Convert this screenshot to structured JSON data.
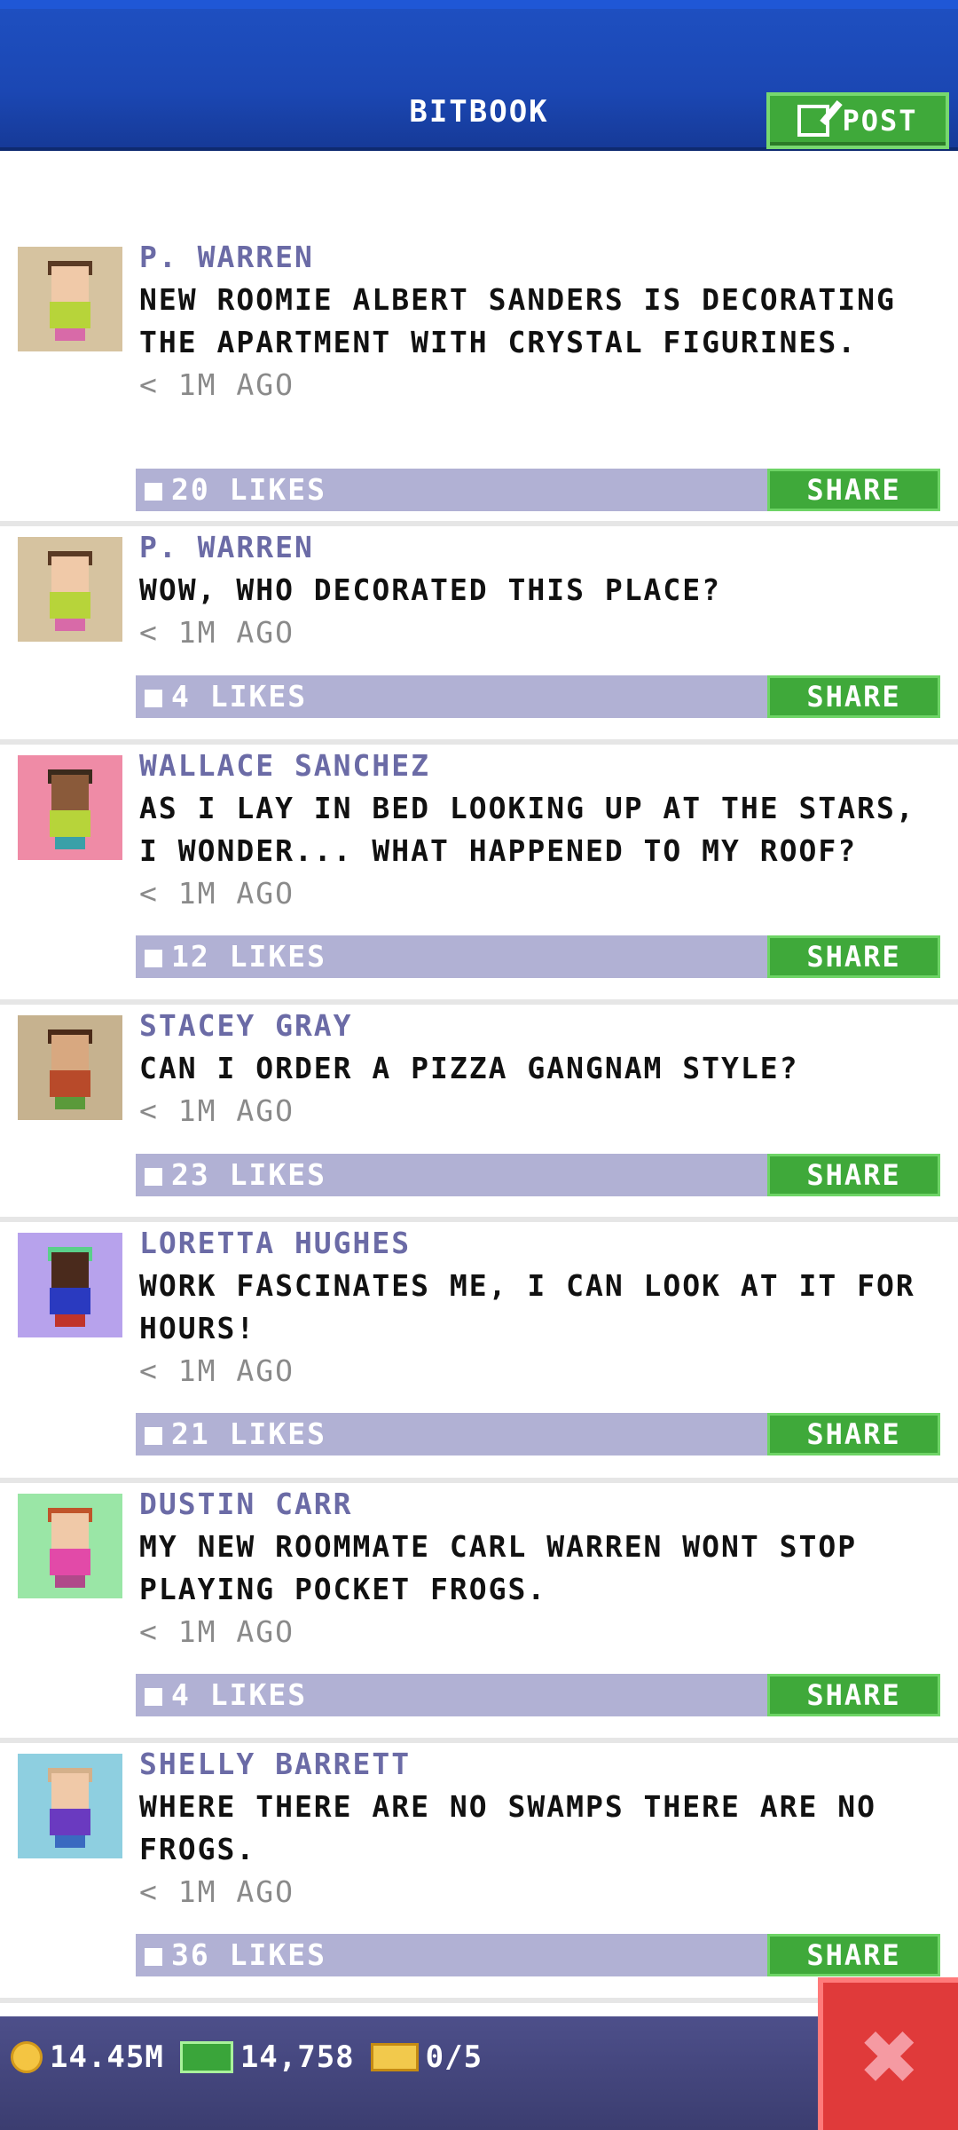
{
  "header": {
    "title": "BITBOOK",
    "post_label": "POST"
  },
  "posts": [
    {
      "author": "P. WARREN",
      "message": "NEW ROOMIE ALBERT SANDERS IS DECORATING THE APARTMENT WITH CRYSTAL FIGURINES.",
      "time": "< 1M AGO",
      "likes": "20 LIKES",
      "share_label": "SHARE",
      "avatar_colors": {
        "bg": "#d6c3a0",
        "hair": "#5a3a24",
        "body": "#b7d43a",
        "legs": "#d86aa8"
      }
    },
    {
      "author": "P. WARREN",
      "message": "WOW, WHO DECORATED THIS PLACE?",
      "time": "< 1M AGO",
      "likes": "4 LIKES",
      "share_label": "SHARE",
      "avatar_colors": {
        "bg": "#d6c3a0",
        "hair": "#5a3a24",
        "body": "#b7d43a",
        "legs": "#d86aa8"
      }
    },
    {
      "author": "WALLACE SANCHEZ",
      "message": "AS I LAY IN BED LOOKING UP AT THE STARS, I WONDER... WHAT HAPPENED TO MY ROOF?",
      "time": "< 1M AGO",
      "likes": "12 LIKES",
      "share_label": "SHARE",
      "avatar_colors": {
        "bg": "#ef8ba6",
        "hair": "#3a2a1c",
        "body": "#b7d43a",
        "legs": "#3aa0a8"
      }
    },
    {
      "author": "STACEY GRAY",
      "message": "CAN I ORDER A PIZZA GANGNAM STYLE?",
      "time": "< 1M AGO",
      "likes": "23 LIKES",
      "share_label": "SHARE",
      "avatar_colors": {
        "bg": "#c6b28f",
        "hair": "#4a2a18",
        "body": "#b84a2a",
        "legs": "#5a9a3a"
      }
    },
    {
      "author": "LORETTA HUGHES",
      "message": "WORK FASCINATES ME, I CAN LOOK AT IT FOR HOURS!",
      "time": "< 1M AGO",
      "likes": "21 LIKES",
      "share_label": "SHARE",
      "avatar_colors": {
        "bg": "#b7a2ec",
        "hair": "#5ad08a",
        "body": "#2a3ac0",
        "legs": "#c0342a"
      }
    },
    {
      "author": "DUSTIN CARR",
      "message": "MY NEW ROOMMATE CARL WARREN WONT STOP PLAYING POCKET FROGS.",
      "time": "< 1M AGO",
      "likes": "4 LIKES",
      "share_label": "SHARE",
      "avatar_colors": {
        "bg": "#9ae6a6",
        "hair": "#c0542a",
        "body": "#e24aa8",
        "legs": "#b04a8a"
      }
    },
    {
      "author": "SHELLY BARRETT",
      "message": "WHERE THERE ARE NO SWAMPS THERE ARE NO FROGS.",
      "time": "< 1M AGO",
      "likes": "36 LIKES",
      "share_label": "SHARE",
      "avatar_colors": {
        "bg": "#8ecfe0",
        "hair": "#d4b08a",
        "body": "#6a3ac0",
        "legs": "#3a6ac0"
      }
    }
  ],
  "bottom_bar": {
    "coins": "14.45M",
    "bux": "14,758",
    "tickets": "0/5"
  },
  "colors": {
    "header_blue": "#1b47b3",
    "accent_green": "#3fa93a",
    "likes_bar": "#b1b1d4",
    "author_purple": "#6b6ba6",
    "close_red": "#e03a3a"
  },
  "icons": {
    "post": "edit-icon",
    "like": "thumbs-up-icon",
    "coin": "coin-icon",
    "bux": "bux-icon",
    "ticket": "ticket-icon",
    "close": "close-icon"
  }
}
